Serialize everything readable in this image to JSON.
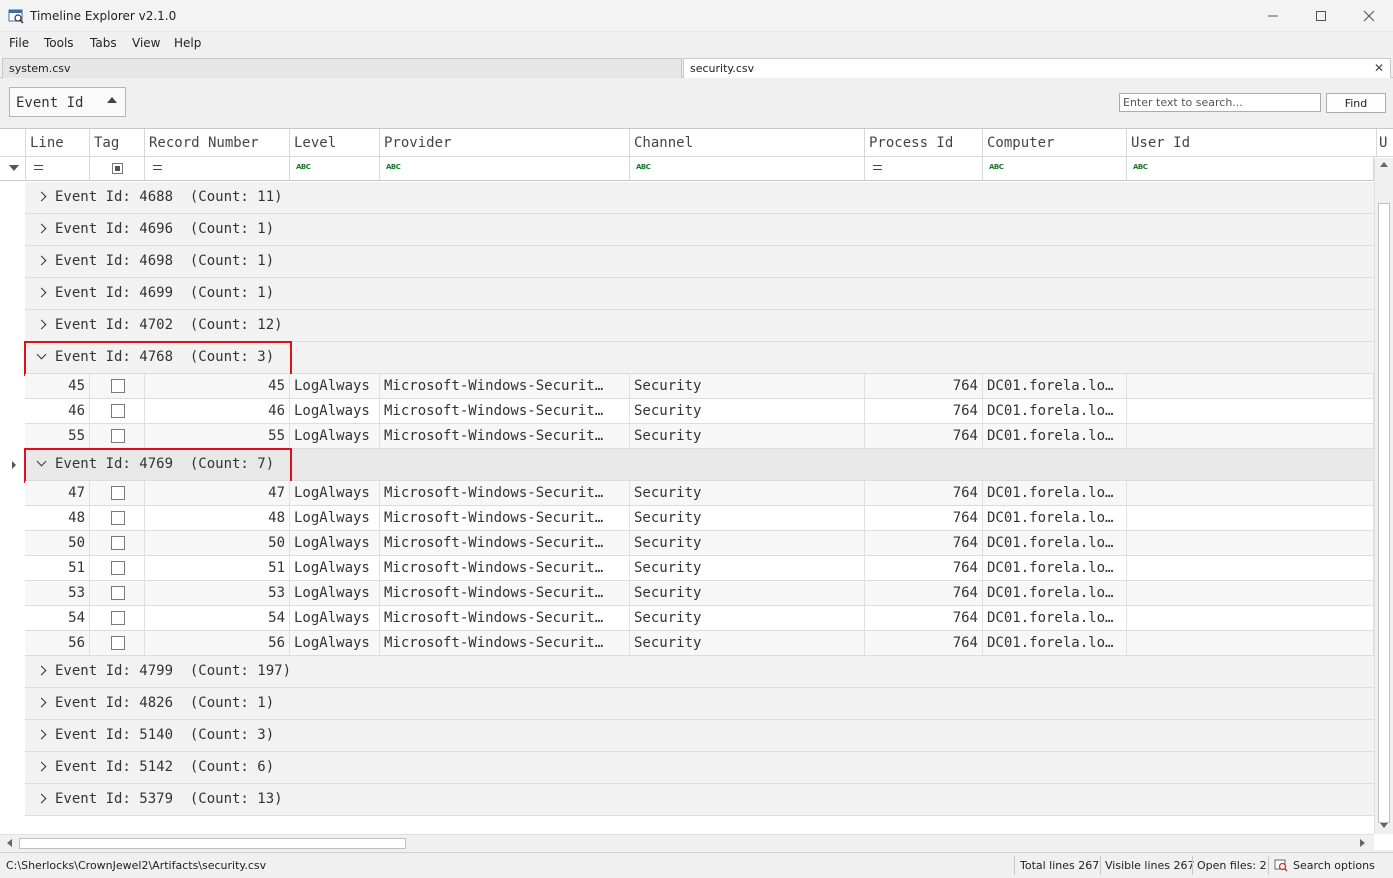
{
  "window": {
    "title": "Timeline Explorer v2.1.0"
  },
  "menu": [
    "File",
    "Tools",
    "Tabs",
    "View",
    "Help"
  ],
  "tabs": [
    {
      "label": "system.csv",
      "active": false
    },
    {
      "label": "security.csv",
      "active": true
    }
  ],
  "group_by": {
    "label": "Event Id"
  },
  "search": {
    "placeholder": "Enter text to search...",
    "find_label": "Find"
  },
  "columns": [
    "Line",
    "Tag",
    "Record Number",
    "Level",
    "Provider",
    "Channel",
    "Process Id",
    "Computer",
    "User Id",
    "U"
  ],
  "groups": [
    {
      "label": "Event Id: 4688  (Count: 11)",
      "expanded": false,
      "rows": []
    },
    {
      "label": "Event Id: 4696  (Count: 1)",
      "expanded": false,
      "rows": []
    },
    {
      "label": "Event Id: 4698  (Count: 1)",
      "expanded": false,
      "rows": []
    },
    {
      "label": "Event Id: 4699  (Count: 1)",
      "expanded": false,
      "rows": []
    },
    {
      "label": "Event Id: 4702  (Count: 12)",
      "expanded": false,
      "rows": []
    },
    {
      "label": "Event Id: 4768  (Count: 3)",
      "expanded": true,
      "highlighted": true,
      "rows": [
        {
          "line": "45",
          "record": "45",
          "level": "LogAlways",
          "provider": "Microsoft-Windows-Securit…",
          "channel": "Security",
          "process": "764",
          "computer": "DC01.forela.lo…"
        },
        {
          "line": "46",
          "record": "46",
          "level": "LogAlways",
          "provider": "Microsoft-Windows-Securit…",
          "channel": "Security",
          "process": "764",
          "computer": "DC01.forela.lo…"
        },
        {
          "line": "55",
          "record": "55",
          "level": "LogAlways",
          "provider": "Microsoft-Windows-Securit…",
          "channel": "Security",
          "process": "764",
          "computer": "DC01.forela.lo…"
        }
      ]
    },
    {
      "label": "Event Id: 4769  (Count: 7)",
      "expanded": true,
      "highlighted": true,
      "selected": true,
      "rows": [
        {
          "line": "47",
          "record": "47",
          "level": "LogAlways",
          "provider": "Microsoft-Windows-Securit…",
          "channel": "Security",
          "process": "764",
          "computer": "DC01.forela.lo…"
        },
        {
          "line": "48",
          "record": "48",
          "level": "LogAlways",
          "provider": "Microsoft-Windows-Securit…",
          "channel": "Security",
          "process": "764",
          "computer": "DC01.forela.lo…"
        },
        {
          "line": "50",
          "record": "50",
          "level": "LogAlways",
          "provider": "Microsoft-Windows-Securit…",
          "channel": "Security",
          "process": "764",
          "computer": "DC01.forela.lo…"
        },
        {
          "line": "51",
          "record": "51",
          "level": "LogAlways",
          "provider": "Microsoft-Windows-Securit…",
          "channel": "Security",
          "process": "764",
          "computer": "DC01.forela.lo…"
        },
        {
          "line": "53",
          "record": "53",
          "level": "LogAlways",
          "provider": "Microsoft-Windows-Securit…",
          "channel": "Security",
          "process": "764",
          "computer": "DC01.forela.lo…"
        },
        {
          "line": "54",
          "record": "54",
          "level": "LogAlways",
          "provider": "Microsoft-Windows-Securit…",
          "channel": "Security",
          "process": "764",
          "computer": "DC01.forela.lo…"
        },
        {
          "line": "56",
          "record": "56",
          "level": "LogAlways",
          "provider": "Microsoft-Windows-Securit…",
          "channel": "Security",
          "process": "764",
          "computer": "DC01.forela.lo…"
        }
      ]
    },
    {
      "label": "Event Id: 4799  (Count: 197)",
      "expanded": false,
      "rows": []
    },
    {
      "label": "Event Id: 4826  (Count: 1)",
      "expanded": false,
      "rows": []
    },
    {
      "label": "Event Id: 5140  (Count: 3)",
      "expanded": false,
      "rows": []
    },
    {
      "label": "Event Id: 5142  (Count: 6)",
      "expanded": false,
      "rows": []
    },
    {
      "label": "Event Id: 5379  (Count: 13)",
      "expanded": false,
      "rows": []
    }
  ],
  "status": {
    "path": "C:\\Sherlocks\\CrownJewel2\\Artifacts\\security.csv",
    "total_lines": "Total lines 267",
    "visible_lines": "Visible lines 267",
    "open_files": "Open files: 2",
    "search_options": "Search options"
  },
  "colors": {
    "highlight": "#e0101a",
    "filter_abc": "#1a7a2a"
  },
  "icons": [
    "app-icon",
    "minimize-icon",
    "maximize-icon",
    "close-icon",
    "tab-close-icon",
    "sort-asc-icon",
    "filter-funnel-icon",
    "chevron-right-icon",
    "chevron-down-icon",
    "search-options-icon"
  ]
}
